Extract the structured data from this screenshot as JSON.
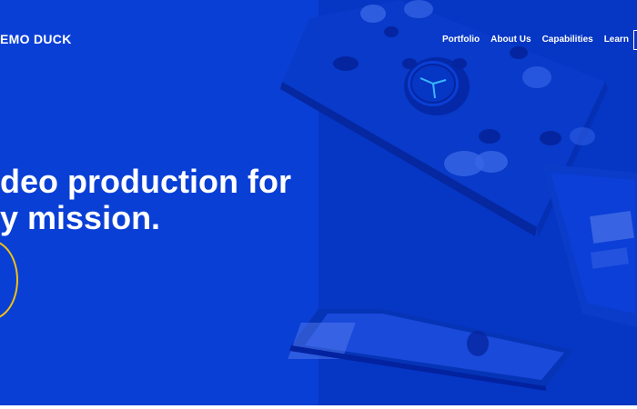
{
  "brand": {
    "logo_text": "EMO DUCK"
  },
  "nav": {
    "items": [
      "Portfolio",
      "About Us",
      "Capabilities",
      "Learn"
    ]
  },
  "hero": {
    "headline_line1": "deo production for",
    "headline_line2": "y mission."
  },
  "colors": {
    "hero_bg": "#0a3fd6",
    "hero_bg_right": "#0636c4",
    "accent_ring": "#f1c20f",
    "text": "#ffffff"
  },
  "icons": {
    "play": "play-circle-icon",
    "clock": "alarm-clock-icon"
  }
}
